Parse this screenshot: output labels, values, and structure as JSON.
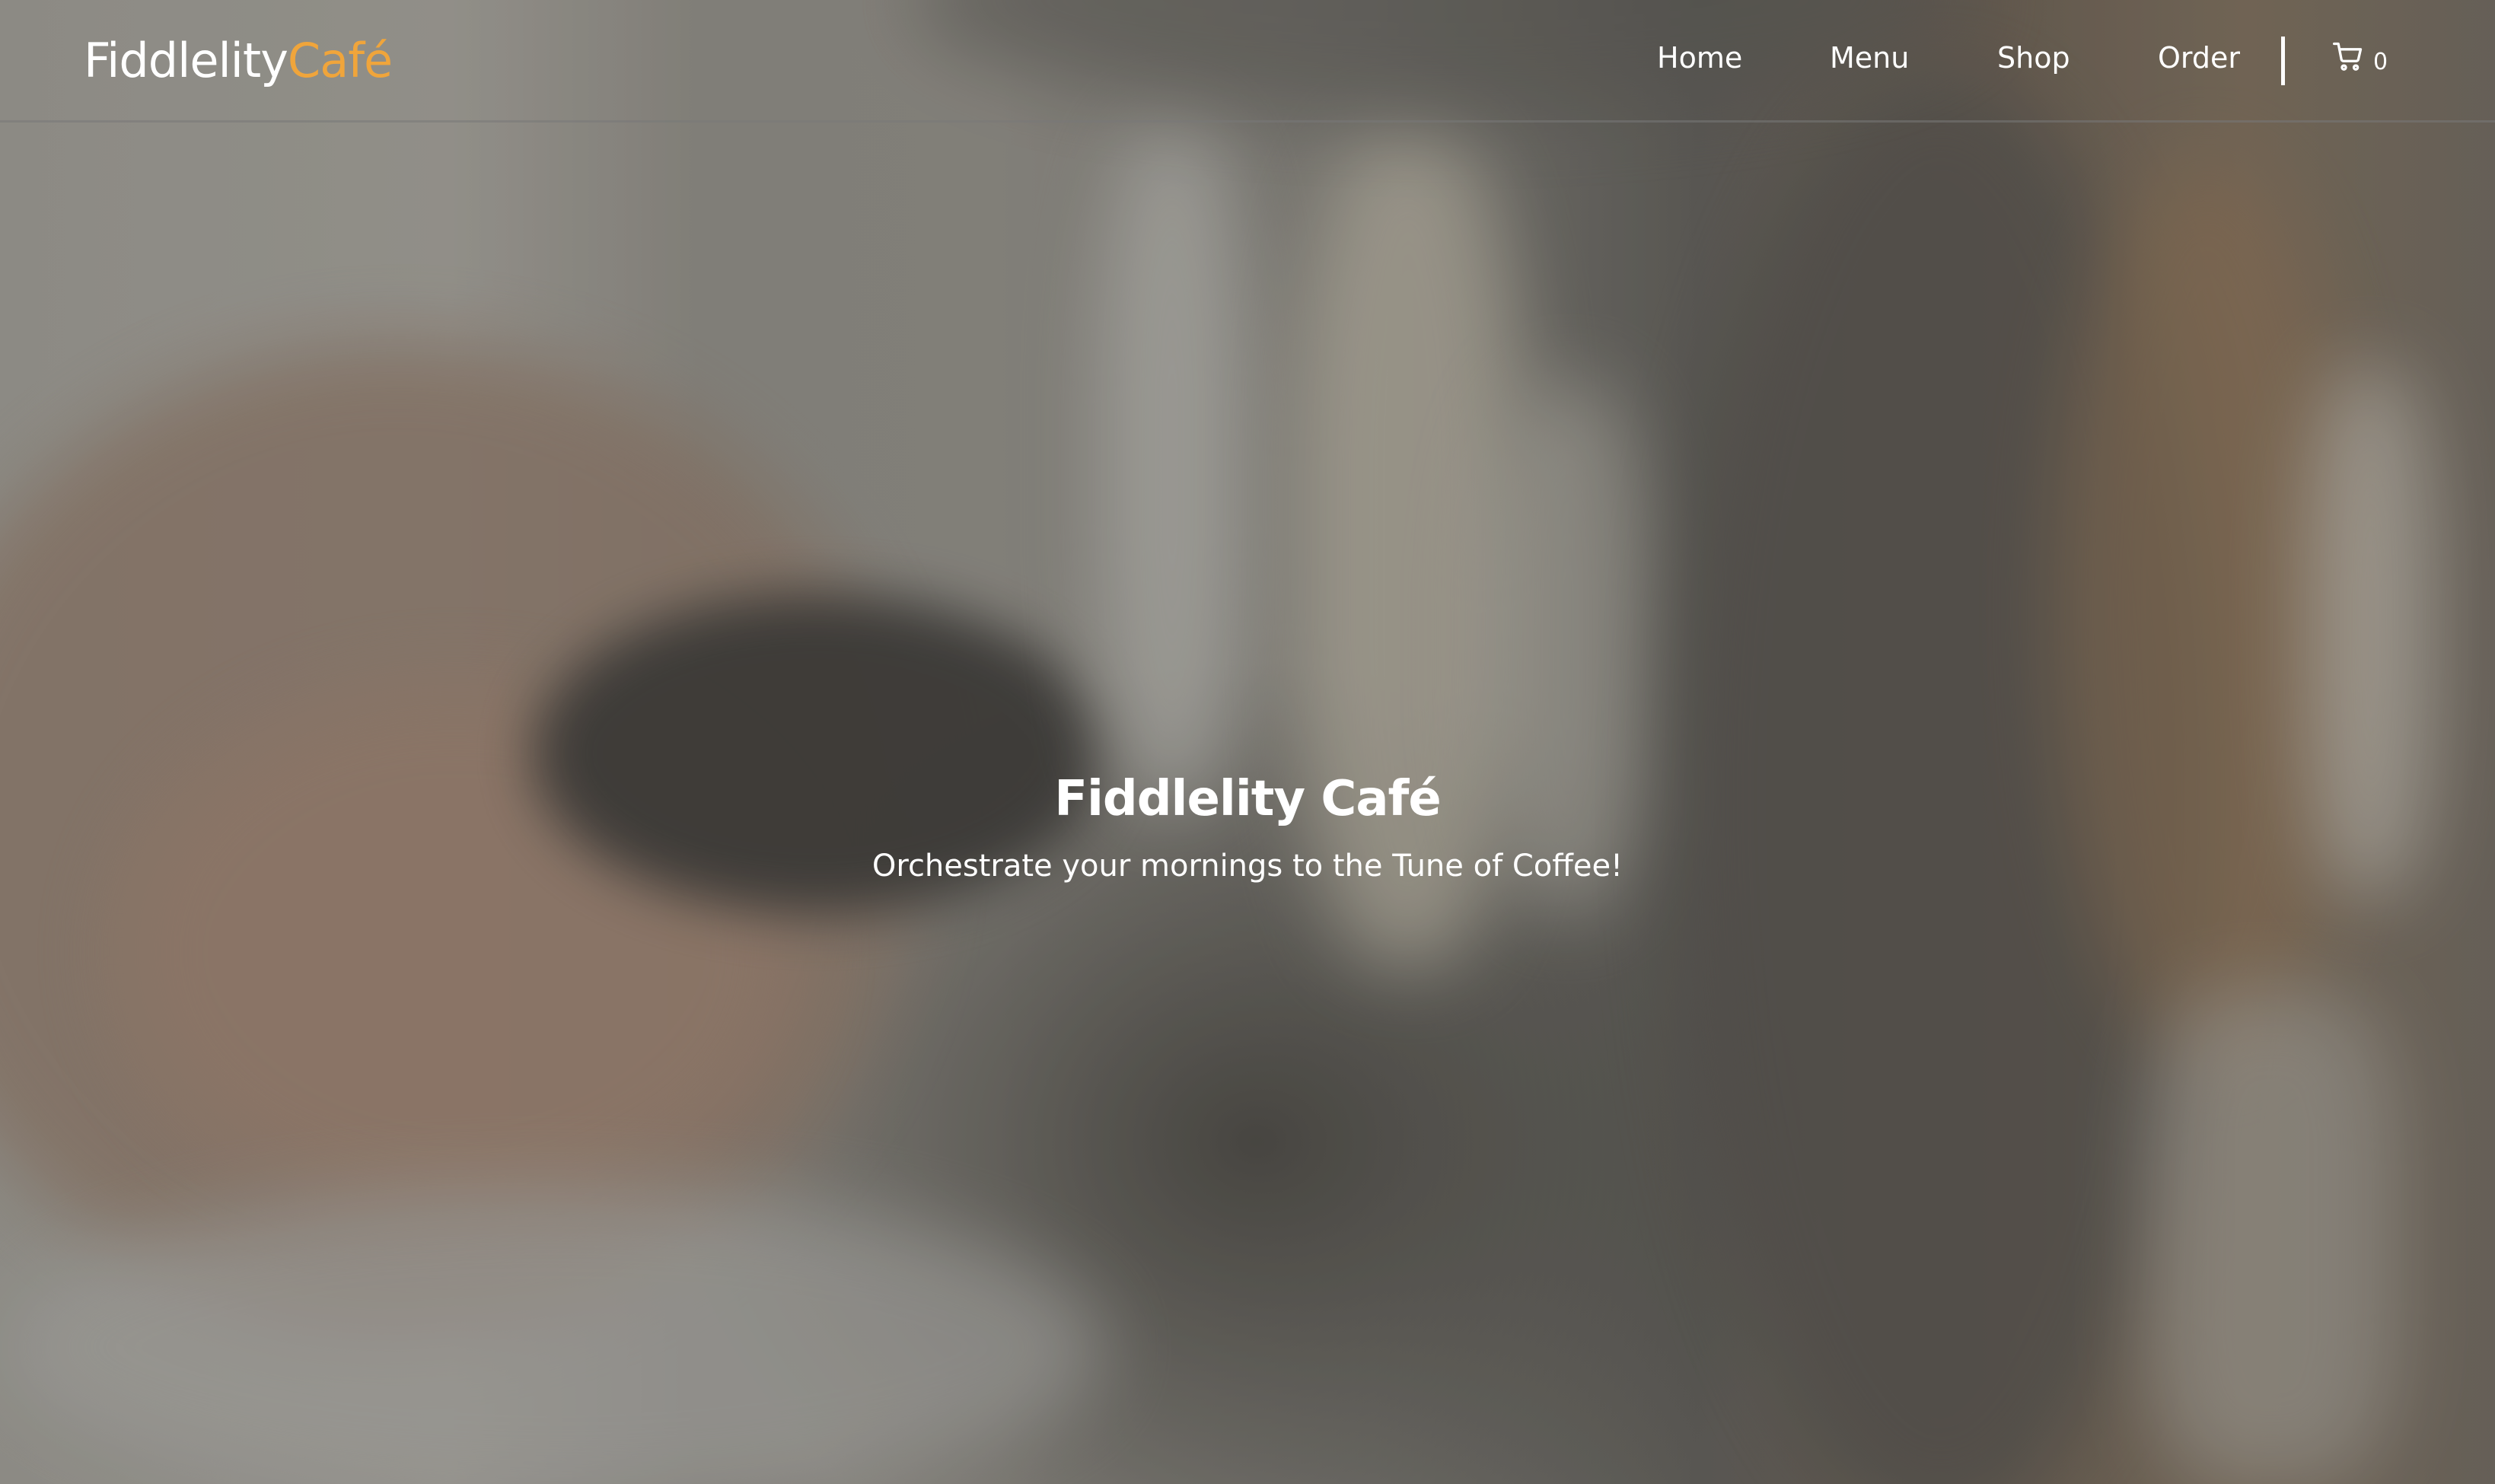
{
  "brand": {
    "name_main": "Fiddlelity",
    "name_accent": "Café",
    "accent_color": "#f0a53b"
  },
  "nav": {
    "items": [
      {
        "label": "Home"
      },
      {
        "label": "Menu"
      },
      {
        "label": "Shop"
      },
      {
        "label": "Order"
      }
    ],
    "cart": {
      "icon": "shopping-cart-icon",
      "count": "0"
    }
  },
  "hero": {
    "title": "Fiddlelity Café",
    "subtitle": "Orchestrate your mornings to the Tune of Coffee!"
  }
}
